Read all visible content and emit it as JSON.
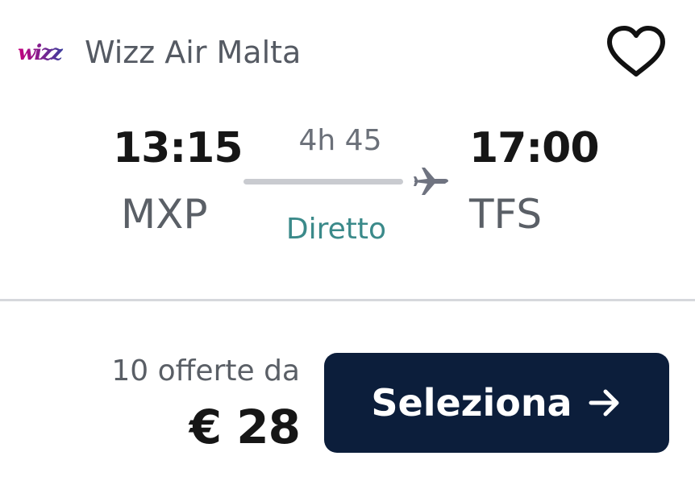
{
  "airline": {
    "logo_text": "wizz",
    "name": "Wizz Air Malta",
    "favorite_icon": "heart-outline-icon"
  },
  "flight": {
    "departure_time": "13:15",
    "departure_airport": "MXP",
    "duration": "4h 45",
    "stops": "Diretto",
    "arrival_time": "17:00",
    "arrival_airport": "TFS",
    "route_icon": "plane-icon"
  },
  "pricing": {
    "offers_text": "10 offerte da",
    "price": "€ 28"
  },
  "action": {
    "select_label": "Seleziona",
    "select_icon": "arrow-right-icon"
  },
  "colors": {
    "button_bg": "#0c1e3b",
    "stops_text": "#3b8a8a",
    "logo": "#c6007e"
  }
}
